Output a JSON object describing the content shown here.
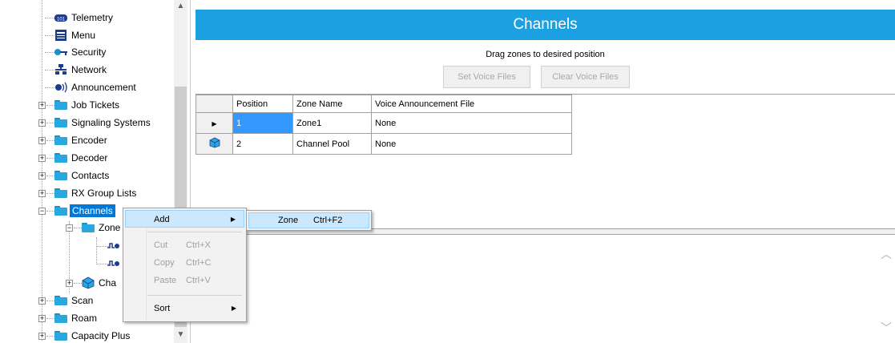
{
  "tree": {
    "items": [
      {
        "label": "Telemetry",
        "icon": "telemetry-icon"
      },
      {
        "label": "Menu",
        "icon": "menu-icon"
      },
      {
        "label": "Security",
        "icon": "key-icon"
      },
      {
        "label": "Network",
        "icon": "network-icon"
      },
      {
        "label": "Announcement",
        "icon": "announcement-icon"
      },
      {
        "label": "Job Tickets",
        "icon": "folder-icon"
      },
      {
        "label": "Signaling Systems",
        "icon": "folder-icon"
      },
      {
        "label": "Encoder",
        "icon": "folder-icon"
      },
      {
        "label": "Decoder",
        "icon": "folder-icon"
      },
      {
        "label": "Contacts",
        "icon": "folder-icon"
      },
      {
        "label": "RX Group Lists",
        "icon": "folder-icon"
      },
      {
        "label": "Channels",
        "icon": "folder-icon"
      },
      {
        "label": "Zone",
        "icon": "folder-icon"
      },
      {
        "label": "",
        "icon": "channel-icon"
      },
      {
        "label": "",
        "icon": "channel-icon"
      },
      {
        "label": "Cha",
        "icon": "cube-icon"
      },
      {
        "label": "Scan",
        "icon": "folder-icon"
      },
      {
        "label": "Roam",
        "icon": "folder-icon"
      },
      {
        "label": "Capacity Plus",
        "icon": "folder-icon"
      }
    ],
    "expand_plus": "+",
    "expand_minus": "−"
  },
  "panel": {
    "title": "Channels",
    "hint": "Drag zones to desired position",
    "set_voice_files": "Set Voice Files",
    "clear_voice_files": "Clear Voice Files"
  },
  "grid": {
    "columns": [
      "Position",
      "Zone Name",
      "Voice Announcement File"
    ],
    "rows": [
      {
        "position": "1",
        "zone_name": "Zone1",
        "voice_file": "None"
      },
      {
        "position": "2",
        "zone_name": "Channel Pool",
        "voice_file": "None"
      }
    ]
  },
  "context_menu": {
    "add": "Add",
    "cut": "Cut",
    "cut_shortcut": "Ctrl+X",
    "copy": "Copy",
    "copy_shortcut": "Ctrl+C",
    "paste": "Paste",
    "paste_shortcut": "Ctrl+V",
    "sort": "Sort",
    "submenu_arrow": "▶"
  },
  "submenu": {
    "zone": "Zone",
    "zone_shortcut": "Ctrl+F2"
  },
  "glyphs": {
    "scroll_up": "▲",
    "scroll_down": "▼",
    "chevron_up": "︿",
    "chevron_down": "﹀",
    "row_pointer": "▶",
    "cube": "⬢"
  },
  "colors": {
    "header_bg": "#1ba1e2",
    "selection": "#0078d7",
    "menu_highlight": "#cce8ff"
  }
}
